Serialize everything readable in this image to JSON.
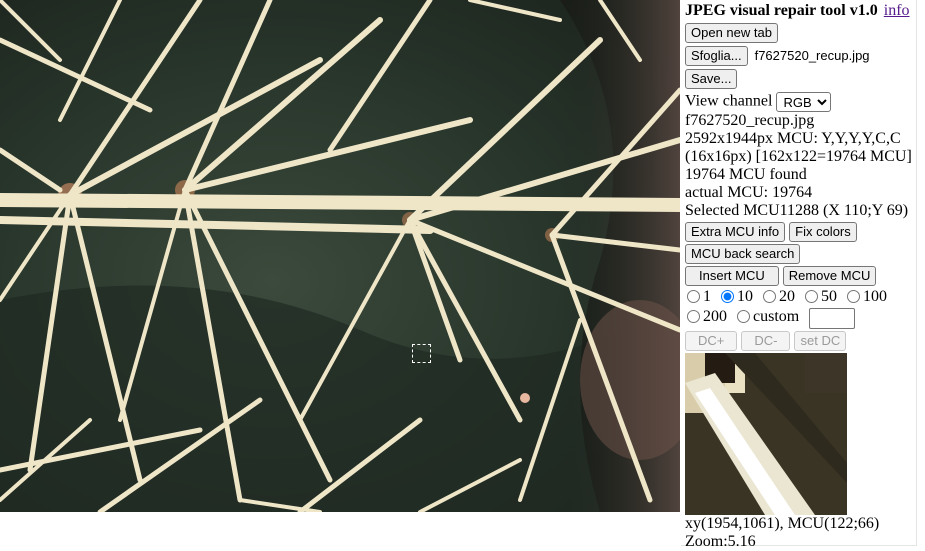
{
  "app": {
    "title": "JPEG visual repair tool v1.0",
    "info_link": "info"
  },
  "toolbar": {
    "open_new_tab": "Open new tab",
    "browse": "Sfoglia...",
    "filename": "f7627520_recup.jpg",
    "save": "Save..."
  },
  "view_channel": {
    "label": "View channel",
    "selected": "RGB"
  },
  "file_info": {
    "name": "f7627520_recup.jpg",
    "dims_mcu": "2592x1944px MCU: Y,Y,Y,Y,C,C",
    "mcu_grid": "(16x16px) [162x122=19764 MCU]",
    "found": "19764 MCU found",
    "actual": "actual MCU: 19764",
    "selected": "Selected MCU11288 (X 110;Y 69)"
  },
  "actions": {
    "extra_info": "Extra MCU info",
    "fix_colors": "Fix colors",
    "back_search": "MCU back search",
    "insert": "Insert MCU",
    "remove": "Remove MCU"
  },
  "step_options": [
    "1",
    "10",
    "20",
    "50",
    "100",
    "200"
  ],
  "step_selected": "10",
  "custom_label": "custom",
  "custom_value": "",
  "dc": {
    "plus": "DC+",
    "minus": "DC-",
    "set": "set DC"
  },
  "status": {
    "coords": "xy(1954,1061), MCU(122;66)",
    "zoom": "Zoom:5.16"
  },
  "colors": {
    "background_dark_green": "#2d3a2f",
    "spine": "#efe6c8",
    "link": "#551a8b"
  }
}
